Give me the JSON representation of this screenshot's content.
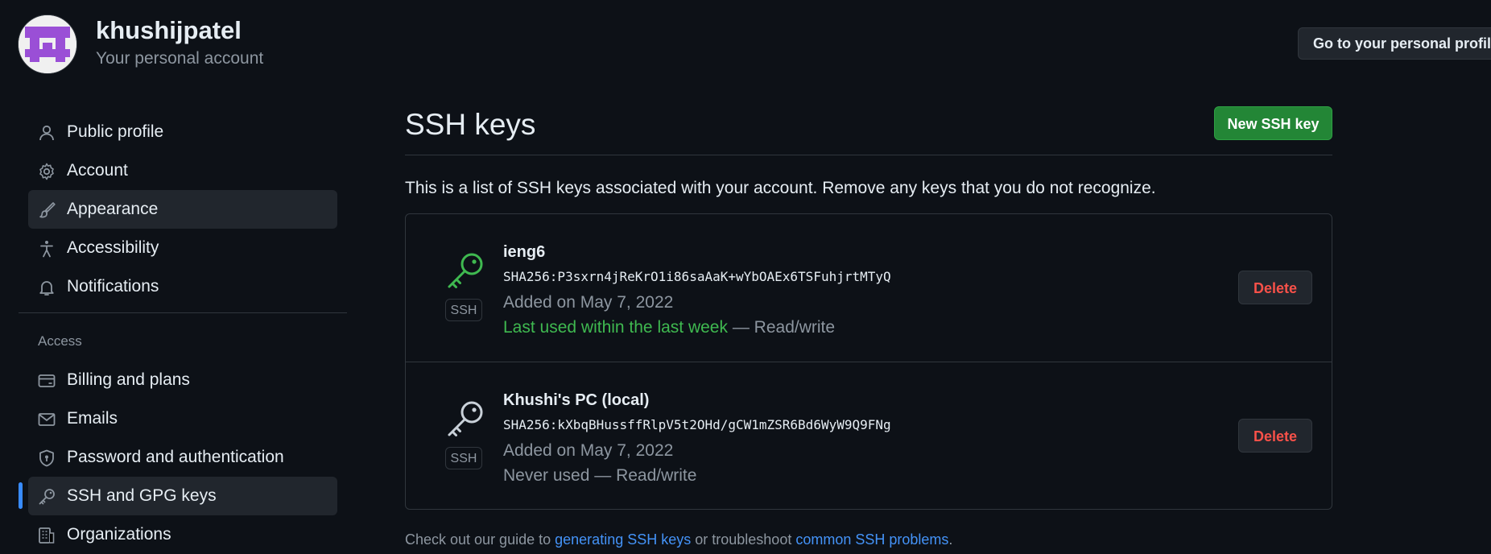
{
  "header": {
    "username": "khushijpatel",
    "subtitle": "Your personal account",
    "profile_button": "Go to your personal profile"
  },
  "sidebar": {
    "items": [
      {
        "label": "Public profile",
        "icon": "person-icon"
      },
      {
        "label": "Account",
        "icon": "gear-icon"
      },
      {
        "label": "Appearance",
        "icon": "paintbrush-icon"
      },
      {
        "label": "Accessibility",
        "icon": "accessibility-icon"
      },
      {
        "label": "Notifications",
        "icon": "bell-icon"
      }
    ],
    "group_title": "Access",
    "access_items": [
      {
        "label": "Billing and plans",
        "icon": "credit-card-icon"
      },
      {
        "label": "Emails",
        "icon": "mail-icon"
      },
      {
        "label": "Password and authentication",
        "icon": "shield-lock-icon"
      },
      {
        "label": "SSH and GPG keys",
        "icon": "key-icon"
      },
      {
        "label": "Organizations",
        "icon": "organization-icon"
      }
    ]
  },
  "main": {
    "title": "SSH keys",
    "new_key_button": "New SSH key",
    "intro": "This is a list of SSH keys associated with your account. Remove any keys that you do not recognize.",
    "keys": [
      {
        "name": "ieng6",
        "fingerprint": "SHA256:P3sxrn4jReKrO1i86saAaK+wYbOAEx6TSFuhjrtMTyQ",
        "added": "Added on May 7, 2022",
        "last_used": "Last used within the last week",
        "access": "— Read/write",
        "badge": "SSH",
        "delete_label": "Delete",
        "icon_color": "#3fb950"
      },
      {
        "name": "Khushi's PC (local)",
        "fingerprint": "SHA256:kXbqBHussffRlpV5t2OHd/gCW1mZSR6Bd6WyW9Q9FNg",
        "added": "Added on May 7, 2022",
        "last_used": "Never used",
        "access": "— Read/write",
        "badge": "SSH",
        "delete_label": "Delete",
        "icon_color": "#8d96a0"
      }
    ],
    "footer": {
      "prefix": "Check out our guide to",
      "link1": "generating SSH keys",
      "middle": "or troubleshoot",
      "link2": "common SSH problems",
      "suffix": "."
    }
  },
  "colors": {
    "background": "#0d1117",
    "accent_green": "#238636",
    "danger": "#f85149",
    "link": "#4493f8",
    "active_indicator": "#388bfd"
  }
}
